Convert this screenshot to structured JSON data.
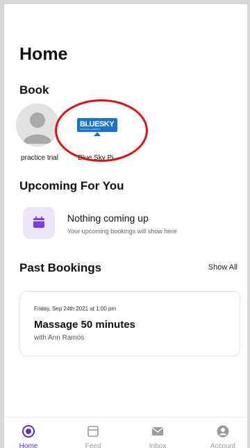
{
  "page": {
    "title": "Home"
  },
  "book": {
    "section_title": "Book",
    "providers": [
      {
        "label": "practice trial",
        "icon": "user-avatar-icon"
      },
      {
        "label": "Blue Sky Pi...",
        "logo_text": "BLUESKY",
        "logo_subtext": "PHYSICAL THERAPY"
      }
    ]
  },
  "upcoming": {
    "section_title": "Upcoming For You",
    "empty_heading": "Nothing coming up",
    "empty_subtext": "Your upcoming bookings will show here",
    "icon": "calendar-icon"
  },
  "past": {
    "section_title": "Past Bookings",
    "show_all": "Show All",
    "bookings": [
      {
        "date": "Friday, Sep 24th 2021 at 1:00 pm",
        "service": "Massage 50 minutes",
        "provider": "with Ann Ramos"
      }
    ]
  },
  "nav": {
    "items": [
      {
        "label": "Home",
        "icon": "home-icon",
        "active": true
      },
      {
        "label": "Feed",
        "icon": "feed-icon",
        "active": false
      },
      {
        "label": "Inbox",
        "icon": "inbox-icon",
        "active": false
      },
      {
        "label": "Account",
        "icon": "account-icon",
        "active": false
      }
    ]
  },
  "colors": {
    "accent": "#5b2fd1",
    "accent_bg": "#ede6fb",
    "logo_blue": "#1a74c9",
    "annotation_red": "#e01010"
  }
}
